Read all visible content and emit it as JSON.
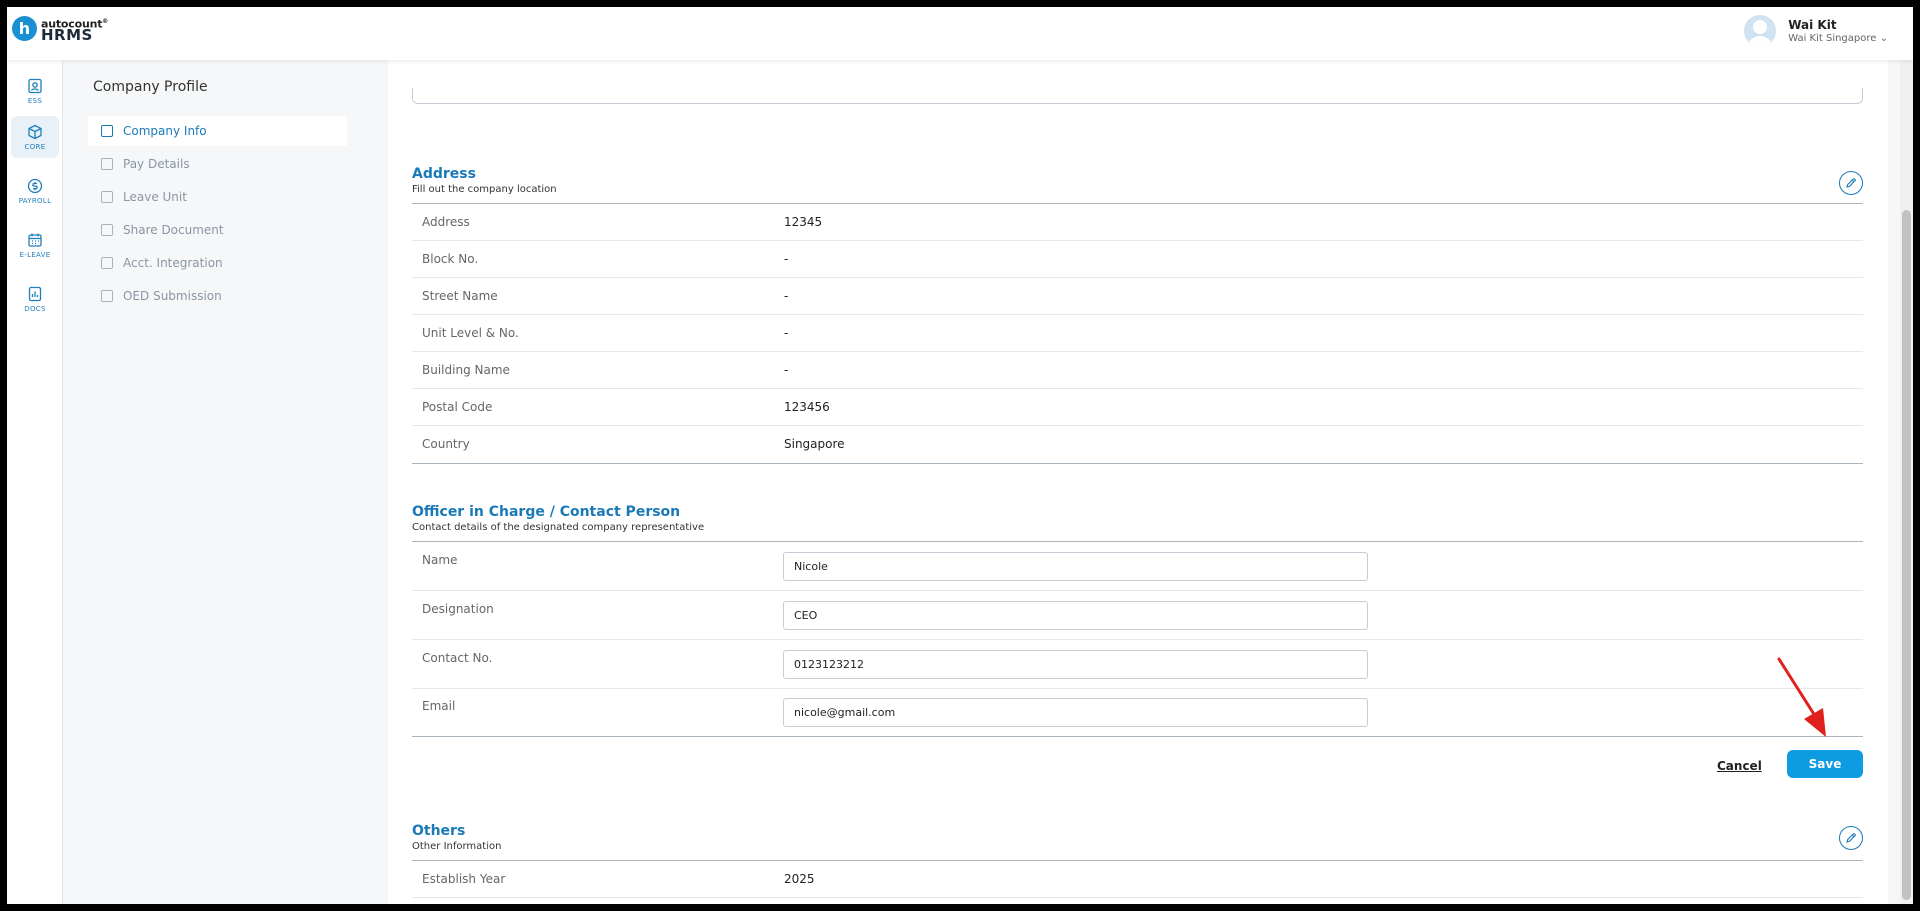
{
  "app": {
    "logo_letter": "h",
    "brand": "autocount",
    "brand_mark": "®",
    "product": "HRMS"
  },
  "user": {
    "name": "Wai Kit",
    "company": "Wai Kit Singapore",
    "chevron": "⌄"
  },
  "rail": [
    {
      "label": "ESS",
      "icon": "ess-icon"
    },
    {
      "label": "CORE",
      "icon": "core-icon"
    },
    {
      "label": "PAYROLL",
      "icon": "payroll-icon"
    },
    {
      "label": "E-LEAVE",
      "icon": "calendar-icon"
    },
    {
      "label": "DOCS",
      "icon": "docs-icon"
    }
  ],
  "page_title": "Company Profile",
  "subnav": [
    {
      "label": "Company Info",
      "icon": "building-icon"
    },
    {
      "label": "Pay Details",
      "icon": "pay-details-icon"
    },
    {
      "label": "Leave Unit",
      "icon": "leave-unit-icon"
    },
    {
      "label": "Share Document",
      "icon": "share-document-icon"
    },
    {
      "label": "Acct. Integration",
      "icon": "integration-icon"
    },
    {
      "label": "OED Submission",
      "icon": "submission-icon"
    }
  ],
  "address": {
    "title": "Address",
    "subtitle": "Fill out the company location",
    "rows": [
      {
        "label": "Address",
        "value": "12345"
      },
      {
        "label": "Block No.",
        "value": "-"
      },
      {
        "label": "Street Name",
        "value": "-"
      },
      {
        "label": "Unit Level & No.",
        "value": "-"
      },
      {
        "label": "Building Name",
        "value": "-"
      },
      {
        "label": "Postal Code",
        "value": "123456"
      },
      {
        "label": "Country",
        "value": "Singapore"
      }
    ]
  },
  "officer": {
    "title": "Officer in Charge / Contact Person",
    "subtitle": "Contact details of the designated company representative",
    "fields": [
      {
        "label": "Name",
        "value": "Nicole"
      },
      {
        "label": "Designation",
        "value": "CEO"
      },
      {
        "label": "Contact No.",
        "value": "0123123212"
      },
      {
        "label": "Email",
        "value": "nicole@gmail.com"
      }
    ],
    "cancel_label": "Cancel",
    "save_label": "Save"
  },
  "others": {
    "title": "Others",
    "subtitle": "Other Information",
    "rows": [
      {
        "label": "Establish Year",
        "value": "2025"
      }
    ]
  },
  "colors": {
    "accent": "#1a7ab8",
    "save_button": "#0d9be1",
    "annotation_arrow": "#e0201c"
  }
}
